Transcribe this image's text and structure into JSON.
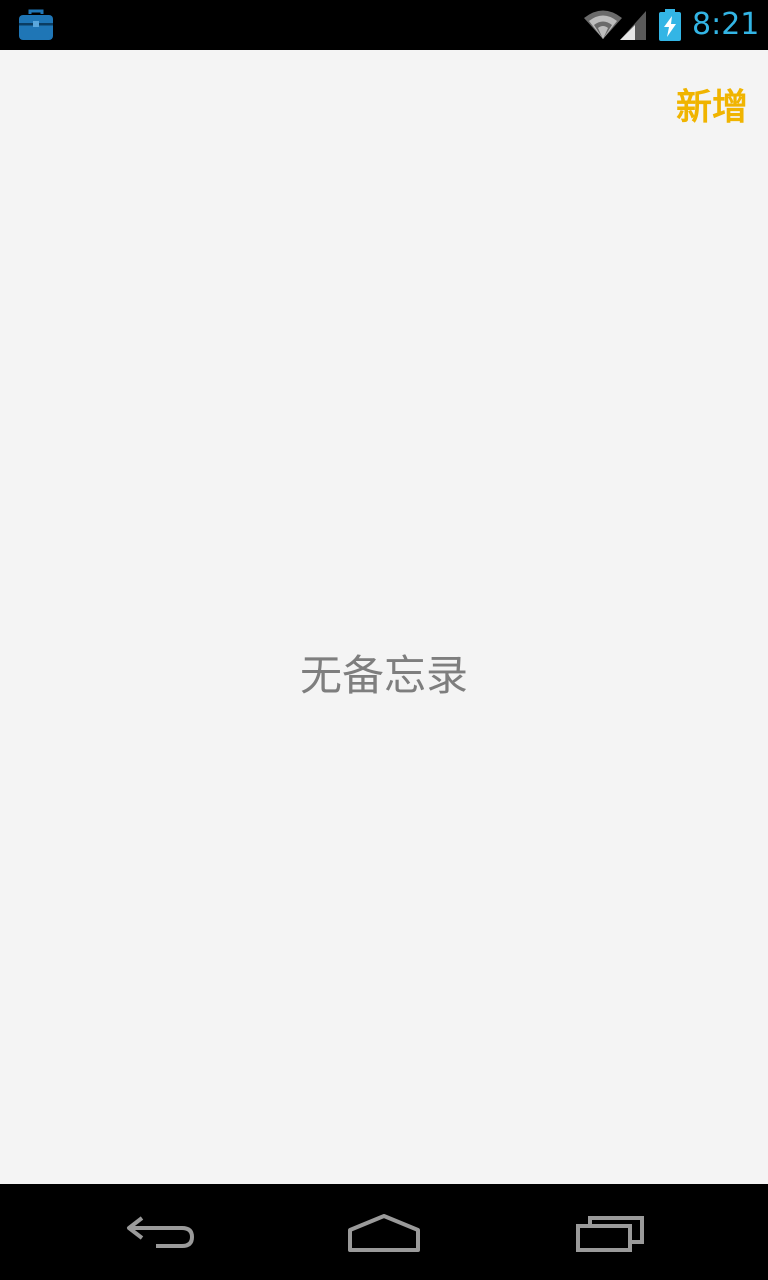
{
  "status_bar": {
    "time": "8:21",
    "icons": [
      "briefcase-icon",
      "wifi-icon",
      "cell-signal-icon",
      "battery-charging-icon"
    ],
    "accent_color": "#33b5e5"
  },
  "header": {
    "add_label": "新增",
    "add_color": "#f0b400"
  },
  "main": {
    "empty_message": "无备忘录"
  },
  "nav_bar": {
    "buttons": [
      "back-icon",
      "home-icon",
      "recents-icon"
    ]
  }
}
